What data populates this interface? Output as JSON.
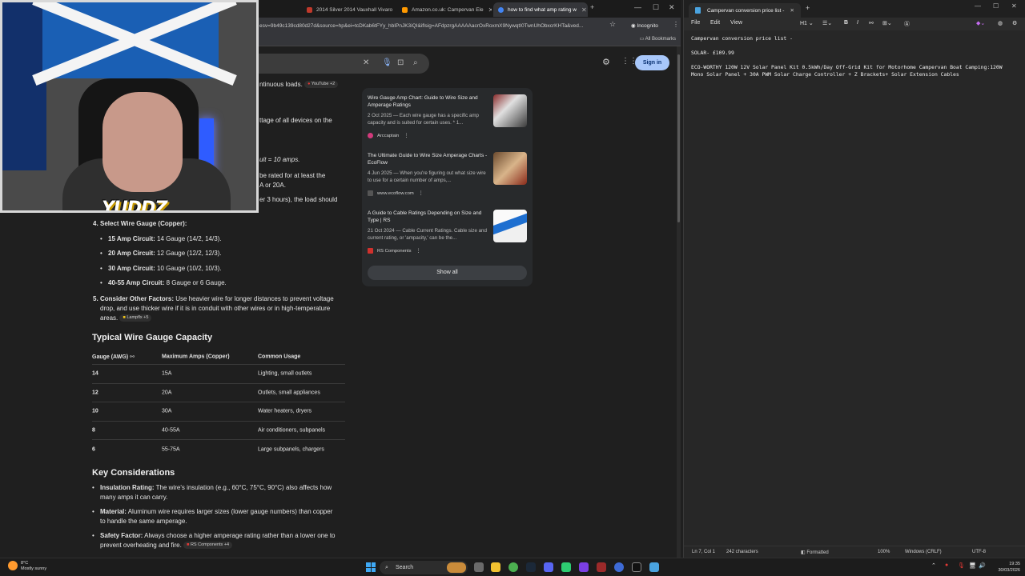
{
  "browser": {
    "tabs": [
      {
        "label": "2014 Silver 2014 Vauxhall Vivaro",
        "color": "#c0392b"
      },
      {
        "label": "Amazon.co.uk: Campervan Ele",
        "color": "#ff9900"
      },
      {
        "label": "how to find what amp rating w",
        "color": "#4285f4",
        "active": true
      }
    ],
    "url": "esv=9b49c139cd80d27d&source=hp&ei=tcDKab6tFYy_hbIPnJK3iQI&iflsig=AFdpzrgAAAAAacrOxRoxmX9NywqtI0TwnUhObxcrKHTa&ved...",
    "incognito_label": "Incognito",
    "all_bookmarks": "All Bookmarks",
    "sign_in": "Sign in",
    "ai_overview": {
      "partial_line_1": "ntinuous loads.",
      "chip_youtube": "YouTube +2",
      "partial_line_2": "ttage of all devices on the",
      "partial_line_3": "uit = 10 amps.",
      "partial_line_4": "be rated for at least the",
      "partial_line_5": "A or 20A.",
      "partial_line_6": "er 3 hours), the load should",
      "step4_num": "4.",
      "step4_title": "Select Wire Gauge (Copper):",
      "step4_items": [
        {
          "b": "15 Amp Circuit:",
          "t": " 14 Gauge (14/2, 14/3)."
        },
        {
          "b": "20 Amp Circuit:",
          "t": " 12 Gauge (12/2, 12/3)."
        },
        {
          "b": "30 Amp Circuit:",
          "t": " 10 Gauge (10/2, 10/3)."
        },
        {
          "b": "40-55 Amp Circuit:",
          "t": " 8 Gauge or 6 Gauge."
        }
      ],
      "step5_num": "5.",
      "step5_title": "Consider Other Factors:",
      "step5_text_1": " Use heavier wire for longer distances to prevent voltage",
      "step5_text_2": "drop, and use thicker wire if it is in conduit with other wires or in high-temperature",
      "step5_text_3": "areas.",
      "chip_lampflx": "Lampflx +5",
      "table_heading": "Typical Wire Gauge Capacity",
      "table_headers": [
        "Gauge (AWG)",
        "Maximum Amps (Copper)",
        "Common Usage"
      ],
      "table_rows": [
        [
          "14",
          "15A",
          "Lighting, small outlets"
        ],
        [
          "12",
          "20A",
          "Outlets, small appliances"
        ],
        [
          "10",
          "30A",
          "Water heaters, dryers"
        ],
        [
          "8",
          "40-55A",
          "Air conditioners, subpanels"
        ],
        [
          "6",
          "55-75A",
          "Large subpanels, chargers"
        ]
      ],
      "key_heading": "Key Considerations",
      "key_items": [
        {
          "b": "Insulation Rating:",
          "t1": " The wire's insulation (e.g., 60°C, 75°C, 90°C) also affects how",
          "t2": "many amps it can carry."
        },
        {
          "b": "Material:",
          "t1": " Aluminum wire requires larger sizes (lower gauge numbers) than copper",
          "t2": "to handle the same amperage."
        },
        {
          "b": "Safety Factor:",
          "t1": " Always choose a higher amperage rating rather than a lower one to",
          "t2": "prevent overheating and fire."
        }
      ],
      "chip_rs": "RS Components +4"
    },
    "cards": [
      {
        "title": "Wire Gauge Amp Chart: Guide to Wire Size and Amperage Ratings",
        "desc": "2 Oct 2025 — Each wire gauge has a specific amp capacity and is suited for certain uses. * 1...",
        "source": "Arccaptain",
        "src_color": "#d33a7c"
      },
      {
        "title": "The Ultimate Guide to Wire Size Amperage Charts - EcoFlow",
        "desc": "4 Jun 2025 — When you're figuring out what size wire to use for a certain number of amps,...",
        "source": "www.ecoflow.com",
        "src_color": "#444444"
      },
      {
        "title": "A Guide to Cable Ratings Depending on Size and Type | RS",
        "desc": "21 Oct 2024 — Cable Current Ratings. Cable size and current rating, or 'ampacity,' can be the...",
        "source": "RS Components",
        "src_color": "#d0312d"
      }
    ],
    "show_all": "Show all"
  },
  "webcam": {
    "logo": "YUDDZ"
  },
  "notepad": {
    "tab_title": "Campervan conversion price list -",
    "menu": [
      "File",
      "Edit",
      "View"
    ],
    "heading_select": "H1",
    "body": "Campervan conversion price list -\n\nSOLAR- £109.99\n\nECO-WORTHY 120W 12V Solar Panel Kit 0.5kWh/Day Off-Grid Kit for Motorhome Campervan Boat Camping:120W\nMono Solar Panel + 30A PWM Solar Charge Controller + Z Brackets+ Solar Extension Cables",
    "status": {
      "position": "Ln 7, Col 1",
      "chars": "242 characters",
      "format": "Formatted",
      "zoom": "100%",
      "eol": "Windows (CRLF)",
      "encoding": "UTF-8"
    }
  },
  "taskbar": {
    "temp": "8°C",
    "weather": "Mostly sunny",
    "search": "Search",
    "time": "19:35",
    "date": "30/03/2026"
  }
}
